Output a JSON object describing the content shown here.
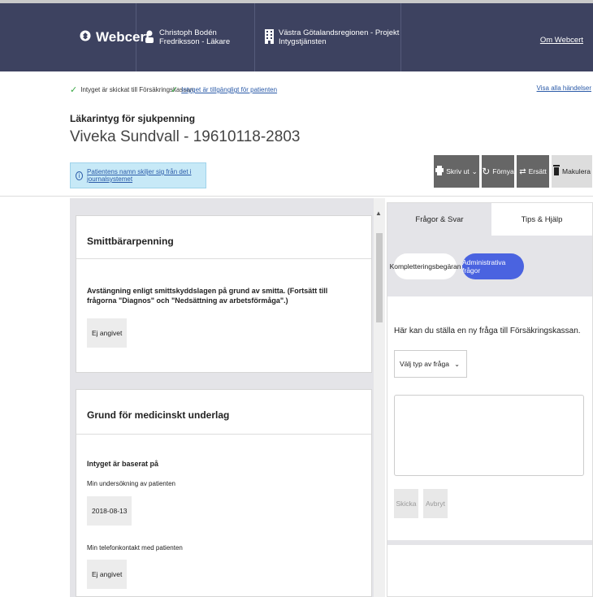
{
  "header": {
    "logo": "Webcert",
    "user": "Christoph Bodén Fredriksson - Läkare",
    "unit": "Västra Götalandsregionen - Projekt Intygstjänsten",
    "about_link": "Om Webcert"
  },
  "status": {
    "sent": "Intyget är skickat till Försäkringskassan",
    "available": "Intyget är tillgängligt för patienten",
    "all_events": "Visa alla händelser"
  },
  "certificate": {
    "type": "Läkarintyg för sjukpenning",
    "patient": "Viveka Sundvall - 19610118-2803"
  },
  "info": {
    "text": "Patientens namn skiljer sig från det i journalsystemet"
  },
  "toolbar": {
    "print": "Skriv ut",
    "renew": "Förnya",
    "replace": "Ersätt",
    "cancel": "Makulera"
  },
  "cards": {
    "smitt": {
      "title": "Smittbärarpenning",
      "question": "Avstängning enligt smittskyddslagen på grund av smitta. (Fortsätt till frågorna \"Diagnos\" och \"Nedsättning av arbetsförmåga\".)",
      "value": "Ej angivet"
    },
    "grund": {
      "title": "Grund för medicinskt underlag",
      "question": "Intyget är baserat på",
      "item1_label": "Min undersökning av patienten",
      "item1_value": "2018-08-13",
      "item2_label": "Min telefonkontakt med patienten",
      "item2_value": "Ej angivet"
    }
  },
  "side_panel": {
    "tab_qa": "Frågor & Svar",
    "tab_tips": "Tips & Hjälp",
    "pill_complement": "Kompletteringsbegäran",
    "pill_admin": "Administrativa frågor",
    "ask_text": "Här kan du ställa en ny fråga till Försäkringskassan.",
    "select_value": "Välj typ av fråga",
    "send": "Skicka",
    "abort": "Avbryt"
  },
  "colors": {
    "header_bg": "#3d4260",
    "accent_blue": "#4a63e0",
    "info_bg": "#c7e9f7",
    "check_green": "#3aa845"
  }
}
